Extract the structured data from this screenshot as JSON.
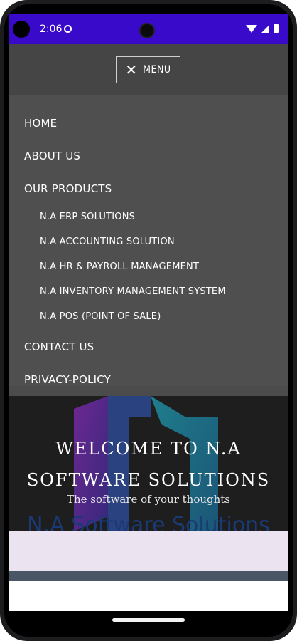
{
  "status_bar": {
    "time": "2:06"
  },
  "menu_toggle": {
    "label": "MENU",
    "icon": "close-icon"
  },
  "menu": {
    "items": [
      {
        "label": "HOME"
      },
      {
        "label": "ABOUT US"
      },
      {
        "label": "OUR PRODUCTS"
      },
      {
        "label": "N.A ERP SOLUTIONS"
      },
      {
        "label": "N.A ACCOUNTING SOLUTION"
      },
      {
        "label": "N.A HR & PAYROLL MANAGEMENT"
      },
      {
        "label": "N.A INVENTORY MANAGEMENT SYSTEM"
      },
      {
        "label": "N.A POS (POINT OF SALE)"
      },
      {
        "label": "CONTACT US"
      },
      {
        "label": "PRIVACY-POLICY"
      }
    ]
  },
  "hero": {
    "title_line1": "WELCOME TO N.A",
    "title_line2": "SOFTWARE SOLUTIONS",
    "tagline": "The software of your thoughts",
    "brand": "N.A Software Solutions"
  },
  "colors": {
    "status_bar": "#3a0acb",
    "menu_bg": "#4f4f4f",
    "hero_bg": "#1e1e1e",
    "brand_text": "#1a3a75"
  }
}
